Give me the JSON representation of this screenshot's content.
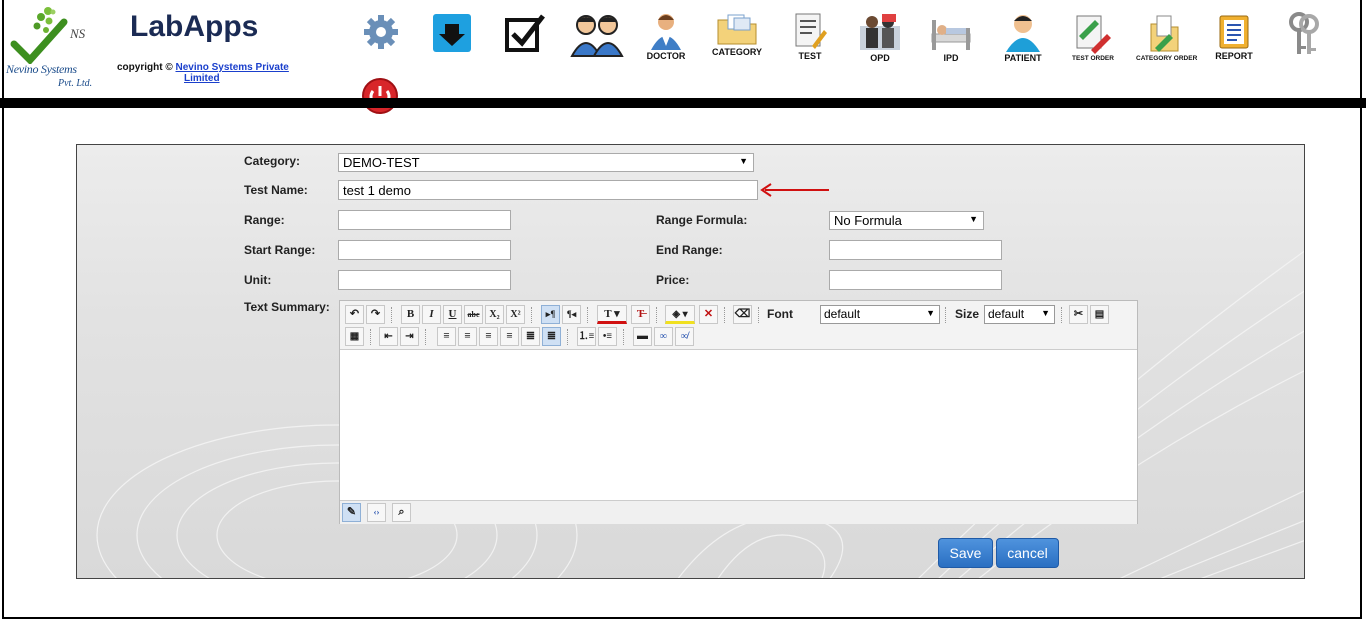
{
  "header": {
    "logo_text": "NS",
    "logo_company": "Nevino Systems",
    "logo_pvt": "Pvt. Ltd.",
    "app_title": "LabApps",
    "copyright_prefix": "copyright ©",
    "copyright_link_1": "Nevino Systems Private",
    "copyright_link_2": "Limited"
  },
  "nav": [
    {
      "icon": "gear-icon",
      "label": ""
    },
    {
      "icon": "download-icon",
      "label": ""
    },
    {
      "icon": "checkbox-icon",
      "label": ""
    },
    {
      "icon": "users-icon",
      "label": ""
    },
    {
      "icon": "doctor-icon",
      "label": "DOCTOR"
    },
    {
      "icon": "folder-icon",
      "label": "CATEGORY"
    },
    {
      "icon": "test-icon",
      "label": "TEST"
    },
    {
      "icon": "opd-icon",
      "label": "OPD"
    },
    {
      "icon": "bed-icon",
      "label": "IPD"
    },
    {
      "icon": "patient-icon",
      "label": "PATIENT"
    },
    {
      "icon": "test-order-icon",
      "label": "TEST ORDER"
    },
    {
      "icon": "category-order-icon",
      "label": "CATEGORY ORDER"
    },
    {
      "icon": "report-icon",
      "label": "REPORT"
    },
    {
      "icon": "keys-icon",
      "label": ""
    }
  ],
  "power_icon": "power-icon",
  "form": {
    "category_label": "Category:",
    "category_value": "DEMO-TEST",
    "test_name_label": "Test Name:",
    "test_name_value": "test 1 demo",
    "range_label": "Range:",
    "range_value": "",
    "range_formula_label": "Range Formula:",
    "range_formula_value": "No Formula",
    "start_range_label": "Start Range:",
    "start_range_value": "",
    "end_range_label": "End Range:",
    "end_range_value": "",
    "unit_label": "Unit:",
    "unit_value": "",
    "price_label": "Price:",
    "price_value": "",
    "text_summary_label": "Text Summary:"
  },
  "editor": {
    "font_label": "Font",
    "font_value": "default",
    "size_label": "Size",
    "size_value": "default",
    "content": ""
  },
  "buttons": {
    "save": "Save",
    "cancel": "cancel"
  },
  "colors": {
    "accent": "#2a6fc2",
    "annotation_arrow": "#d01010",
    "header_bar": "#000000"
  }
}
